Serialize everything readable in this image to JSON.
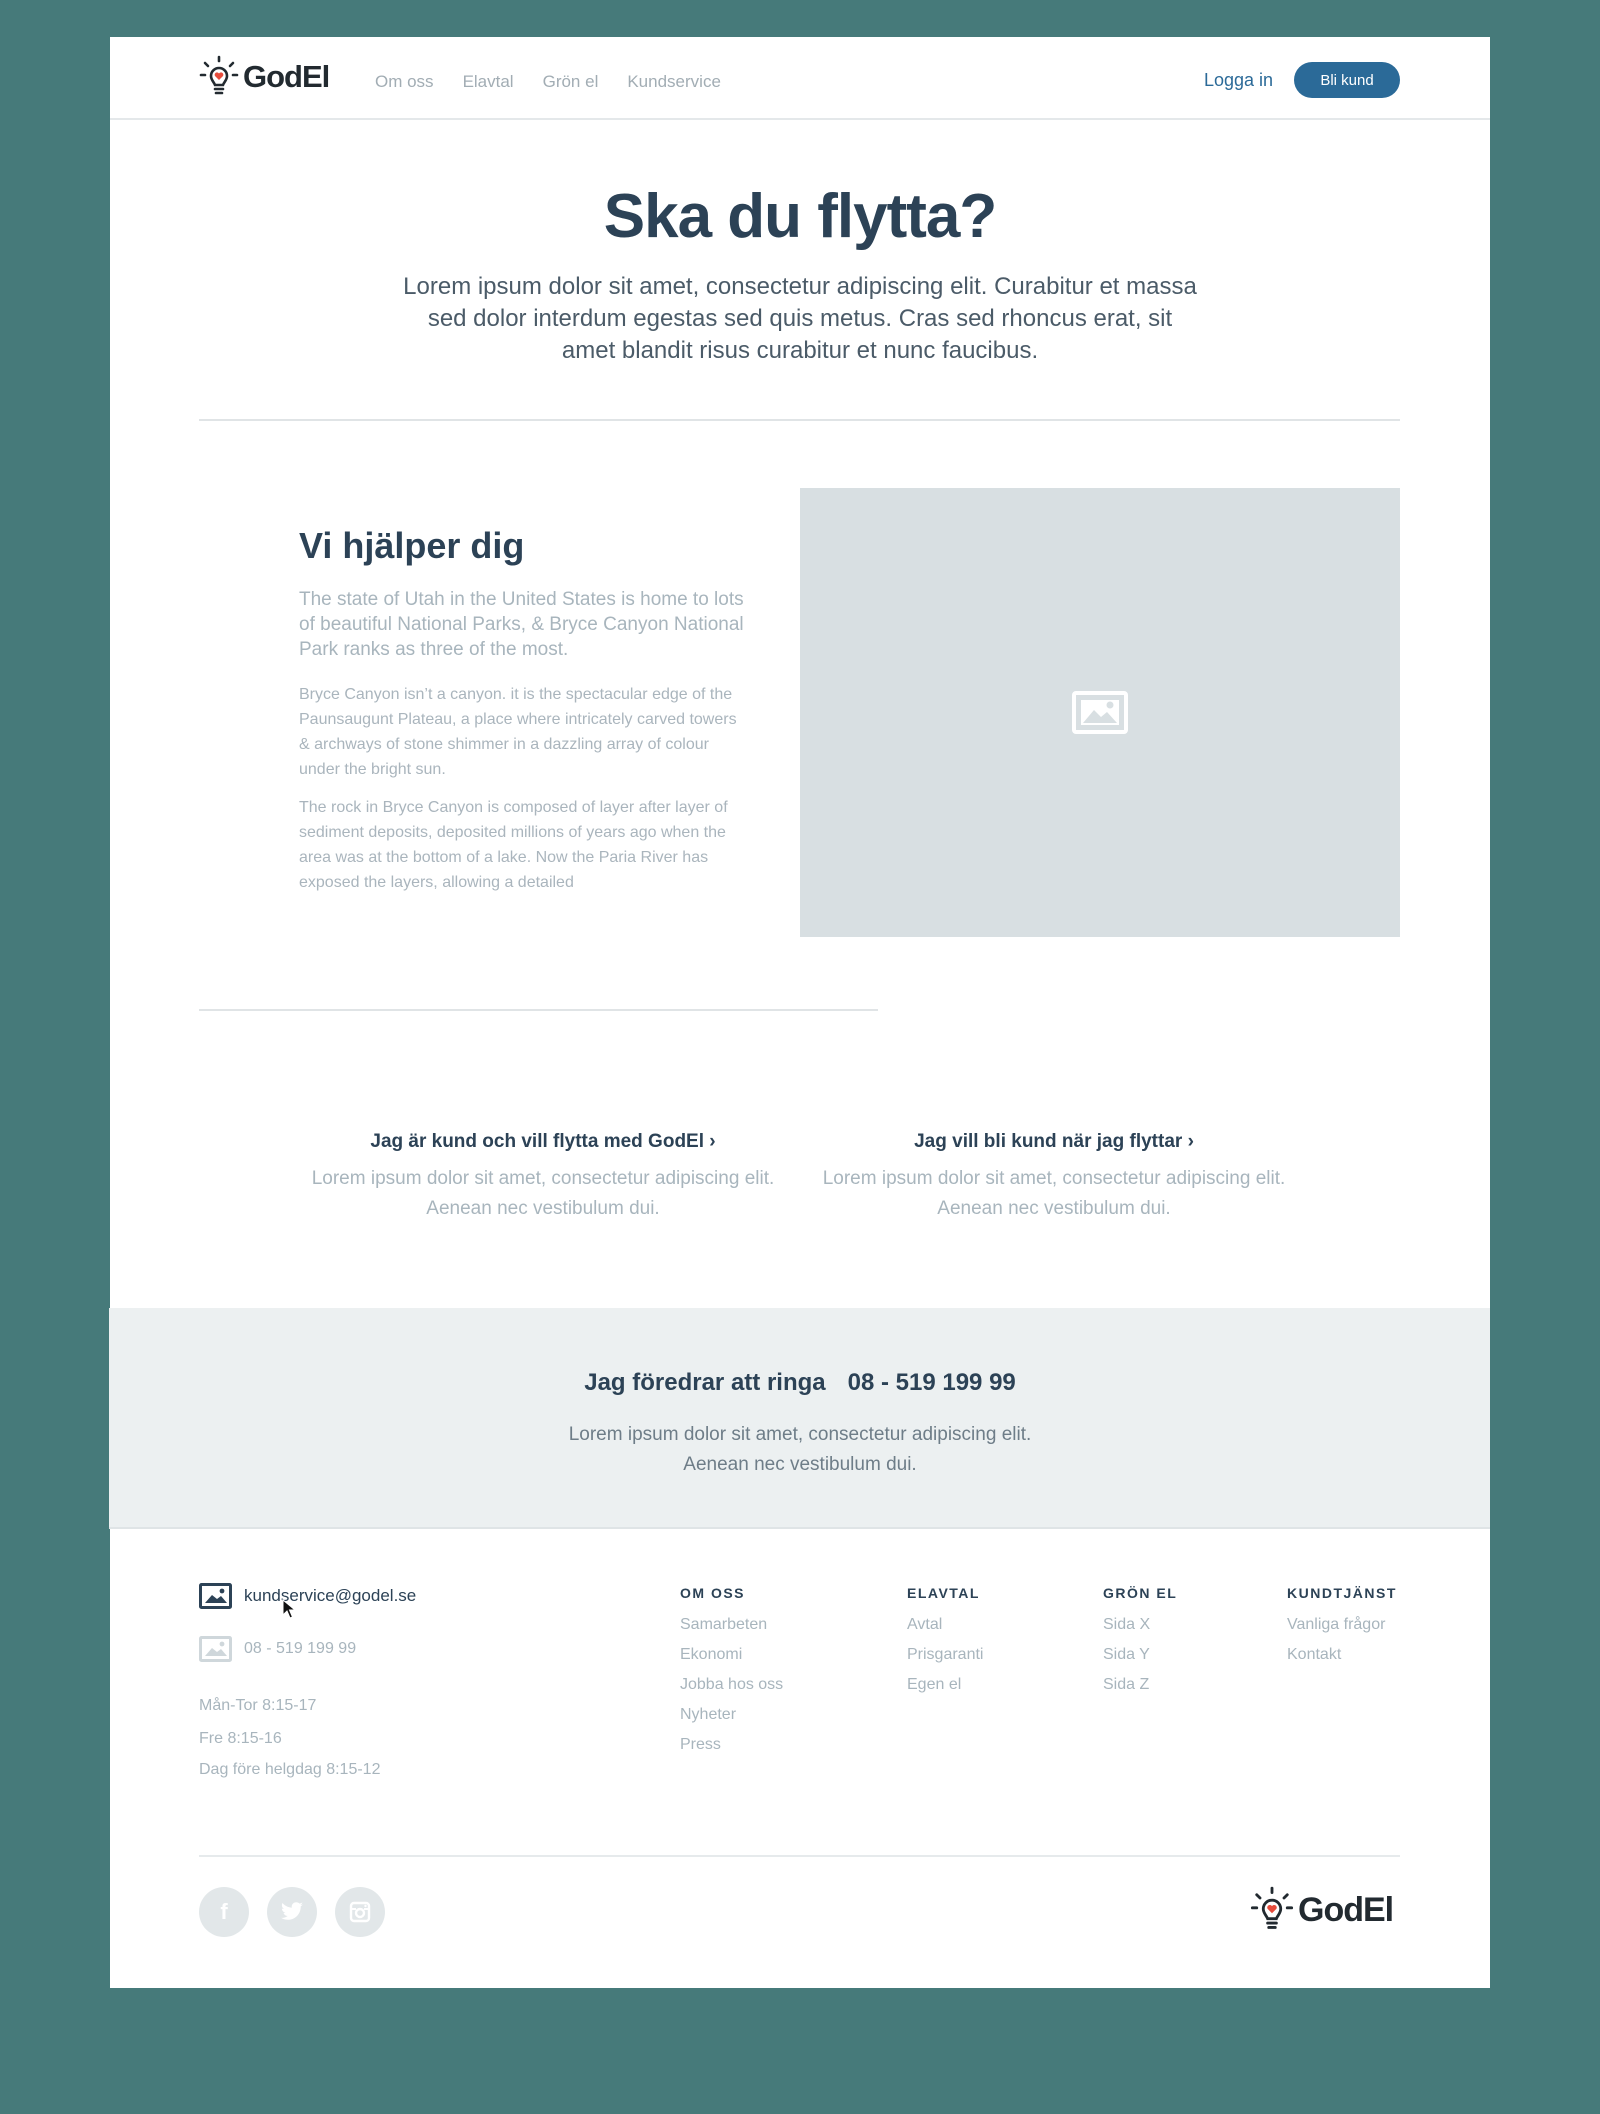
{
  "brand": {
    "name": "GodEl"
  },
  "nav": {
    "items": [
      {
        "label": "Om oss"
      },
      {
        "label": "Elavtal"
      },
      {
        "label": "Grön el"
      },
      {
        "label": "Kundservice"
      }
    ],
    "login_label": "Logga in",
    "cta_label": "Bli kund"
  },
  "hero": {
    "title": "Ska du flytta?",
    "text": "Lorem ipsum dolor sit amet, consectetur adipiscing elit. Curabitur et massa sed dolor interdum egestas sed quis metus. Cras sed rhoncus erat, sit amet blandit risus curabitur et nunc faucibus."
  },
  "help": {
    "title": "Vi hjälper dig",
    "lead": "The state of Utah in the United States is home to lots of beautiful National Parks, & Bryce Canyon National Park ranks as three of the most.",
    "paragraphs": [
      "Bryce Canyon isn’t a canyon. it is the spectacular edge of the Paunsaugunt Plateau, a place where intricately carved towers & archways of stone shimmer in a dazzling array of colour under the bright sun.",
      "The rock in Bryce Canyon is composed of layer after layer of sediment deposits, deposited millions of years ago when the area was at the bottom of a lake. Now the Paria River has exposed the layers, allowing a detailed"
    ],
    "image_icon": "image-placeholder-icon"
  },
  "options": [
    {
      "title": "Jag är kund och vill flytta med GodEl",
      "chevron": "›",
      "text": "Lorem ipsum dolor sit amet, consectetur adipiscing elit. Aenean nec vestibulum dui."
    },
    {
      "title": "Jag vill bli kund när jag flyttar",
      "chevron": "›",
      "text": "Lorem ipsum dolor sit amet, consectetur adipiscing elit. Aenean nec vestibulum dui."
    }
  ],
  "call": {
    "title": "Jag föredrar att ringa",
    "number": "08 - 519 199 99",
    "text_line1": "Lorem ipsum dolor sit amet, consectetur adipiscing elit.",
    "text_line2": "Aenean nec vestibulum dui."
  },
  "footer": {
    "email": "kundservice@godel.se",
    "phone": "08 - 519 199 99",
    "hours": [
      "Mån-Tor 8:15-17",
      "Fre 8:15-16",
      "Dag före helgdag 8:15-12"
    ],
    "columns": [
      {
        "heading": "OM OSS",
        "items": [
          "Samarbeten",
          "Ekonomi",
          "Jobba hos oss",
          "Nyheter",
          "Press"
        ]
      },
      {
        "heading": "ELAVTAL",
        "items": [
          "Avtal",
          "Prisgaranti",
          "Egen el"
        ]
      },
      {
        "heading": "GRÖN EL",
        "items": [
          "Sida X",
          "Sida Y",
          "Sida Z"
        ]
      },
      {
        "heading": "KUNDTJÄNST",
        "items": [
          "Vanliga frågor",
          "Kontakt"
        ]
      }
    ],
    "socials": [
      {
        "icon": "facebook-icon",
        "glyph": "f"
      },
      {
        "icon": "twitter-icon",
        "glyph": ""
      },
      {
        "icon": "instagram-icon",
        "glyph": ""
      }
    ]
  },
  "colors": {
    "background": "#467a7a",
    "primary": "#2b6a98",
    "heading": "#2c4256",
    "muted": "#a8b5bd",
    "band": "#ecf0f1",
    "logo_heart": "#e74c3c"
  }
}
